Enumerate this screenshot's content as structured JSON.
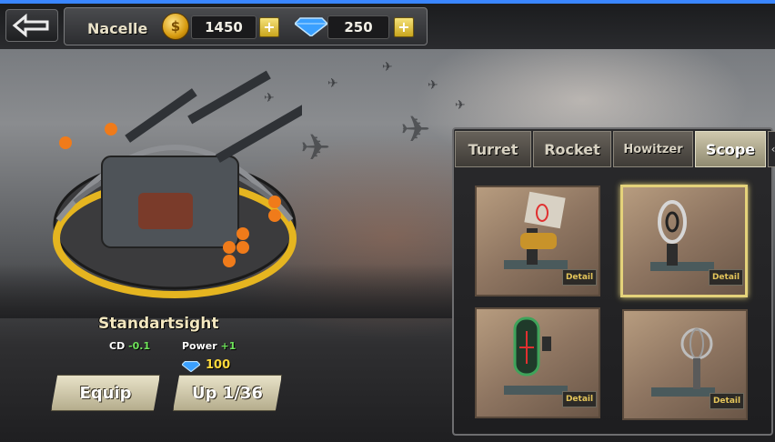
{
  "header": {
    "player_name": "Nacelle",
    "coins": "1450",
    "gems": "250",
    "plus_label": "+",
    "coin_symbol": "$"
  },
  "item": {
    "name": "Standartsight",
    "cd_label": "CD",
    "cd_value": "-0.1",
    "power_label": "Power",
    "power_value": "+1",
    "cost": "100"
  },
  "actions": {
    "equip_label": "Equip",
    "upgrade_label": "Up 1/36"
  },
  "tabs": [
    {
      "label": "Turret",
      "active": false
    },
    {
      "label": "Rocket",
      "active": false
    },
    {
      "label": "Howitzer",
      "active": false
    },
    {
      "label": "Scope",
      "active": true
    }
  ],
  "tab_arrow": "‹",
  "scopes": [
    {
      "detail_label": "Detail",
      "selected": false,
      "icon": "red-ring-scope-icon"
    },
    {
      "detail_label": "Detail",
      "selected": true,
      "icon": "ring-scope-icon"
    },
    {
      "detail_label": "Detail",
      "selected": false,
      "icon": "green-frame-scope-icon"
    },
    {
      "detail_label": "Detail",
      "selected": false,
      "icon": "gyro-scope-icon"
    }
  ],
  "colors": {
    "accent_gold": "#e4d27a",
    "positive_green": "#6ee35a",
    "cost_yellow": "#ffd93b",
    "gem_blue": "#3aa0ff"
  }
}
